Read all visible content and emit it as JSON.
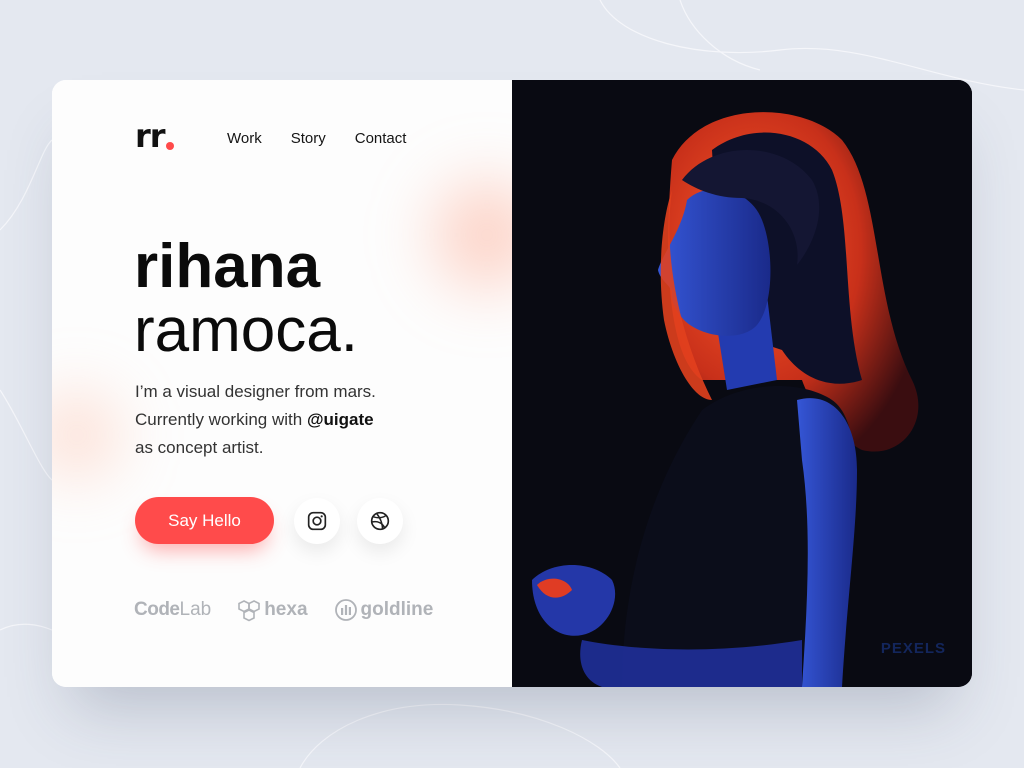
{
  "logo": {
    "text": "rr"
  },
  "nav": {
    "items": [
      "Work",
      "Story",
      "Contact"
    ]
  },
  "hero": {
    "first_name": "rihana",
    "last_name": "ramoca.",
    "desc_line1": "I’m a visual designer from mars.",
    "desc_line2_prefix": "Currently working with ",
    "desc_handle": "@uigate",
    "desc_line3": "as concept artist."
  },
  "cta": {
    "label": "Say Hello"
  },
  "social": {
    "icons": [
      "instagram-icon",
      "dribbble-icon"
    ]
  },
  "brands": {
    "codelab_a": "Code",
    "codelab_b": "Lab",
    "hexa": "hexa",
    "goldline": "goldline"
  },
  "photo": {
    "watermark": "PEXELS"
  },
  "colors": {
    "accent": "#ff4b4b",
    "background": "#e4e8f0",
    "muted": "#b0b3b8"
  }
}
